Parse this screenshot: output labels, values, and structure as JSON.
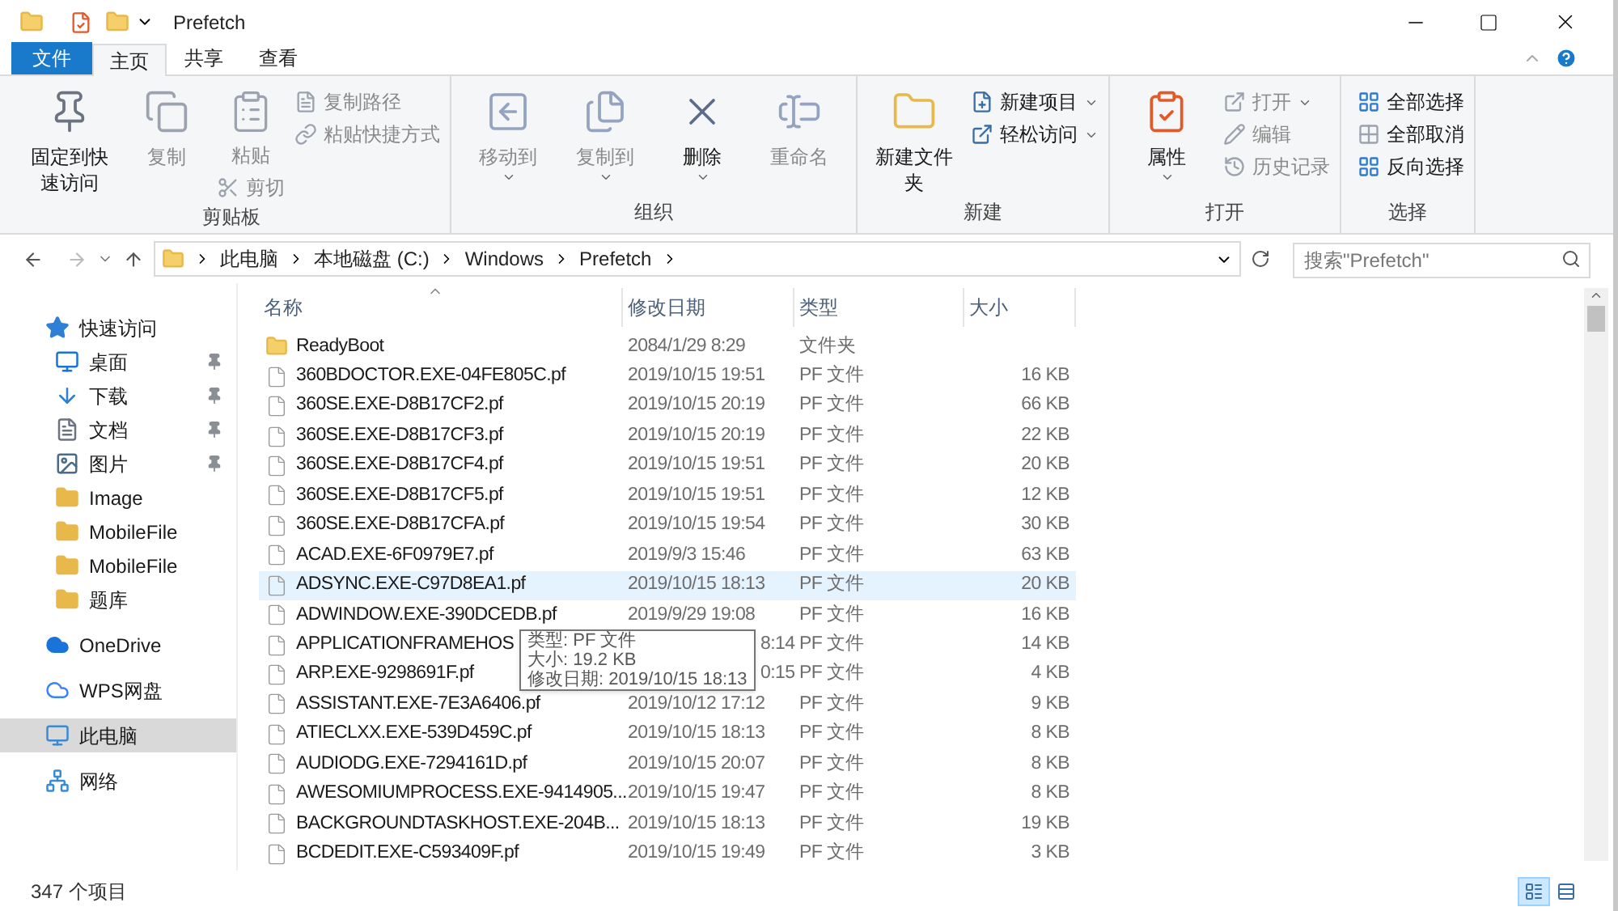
{
  "window": {
    "title": "Prefetch"
  },
  "ribbon_tabs": [
    {
      "label": "文件",
      "kind": "file",
      "selected": false
    },
    {
      "label": "主页",
      "kind": "tab",
      "selected": true
    },
    {
      "label": "共享",
      "kind": "tab",
      "selected": false
    },
    {
      "label": "查看",
      "kind": "tab",
      "selected": false
    }
  ],
  "ribbon_groups": [
    {
      "label": "剪贴板",
      "commands": [
        {
          "label": "固定到快速访问",
          "kind": "large",
          "disabled": false
        },
        {
          "label": "复制",
          "kind": "large",
          "disabled": true
        },
        {
          "label": "粘贴",
          "kind": "paste",
          "disabled": true
        },
        {
          "label": "剪切",
          "kind": "cut",
          "disabled": true
        },
        {
          "label": "复制路径",
          "kind": "small",
          "disabled": true
        },
        {
          "label": "粘贴快捷方式",
          "kind": "small",
          "disabled": true
        }
      ]
    },
    {
      "label": "组织",
      "commands": [
        {
          "label": "移动到",
          "kind": "large",
          "disabled": true,
          "dropdown": true
        },
        {
          "label": "复制到",
          "kind": "large",
          "disabled": true,
          "dropdown": true
        },
        {
          "label": "删除",
          "kind": "large",
          "disabled": false,
          "dropdown": true
        },
        {
          "label": "重命名",
          "kind": "large",
          "disabled": true
        }
      ]
    },
    {
      "label": "新建",
      "commands": [
        {
          "label": "新建文件夹",
          "kind": "large",
          "disabled": false
        },
        {
          "label": "新建项目",
          "kind": "small",
          "disabled": false,
          "dropdown": true
        },
        {
          "label": "轻松访问",
          "kind": "small",
          "disabled": false,
          "dropdown": true
        }
      ]
    },
    {
      "label": "打开",
      "commands": [
        {
          "label": "属性",
          "kind": "large",
          "disabled": false,
          "dropdown": true
        },
        {
          "label": "打开",
          "kind": "small",
          "disabled": true,
          "dropdown": true
        },
        {
          "label": "编辑",
          "kind": "small",
          "disabled": true
        },
        {
          "label": "历史记录",
          "kind": "small",
          "disabled": true
        }
      ]
    },
    {
      "label": "选择",
      "commands": [
        {
          "label": "全部选择",
          "kind": "small",
          "disabled": false
        },
        {
          "label": "全部取消",
          "kind": "small",
          "disabled": false
        },
        {
          "label": "反向选择",
          "kind": "small",
          "disabled": false
        }
      ]
    }
  ],
  "address": {
    "breadcrumbs": [
      "此电脑",
      "本地磁盘 (C:)",
      "Windows",
      "Prefetch"
    ]
  },
  "search": {
    "placeholder": "搜索\"Prefetch\""
  },
  "sidebar": [
    {
      "label": "快速访问",
      "kind": "star",
      "selected": false,
      "children": [
        {
          "label": "桌面",
          "kind": "desktop",
          "pinned": true,
          "selected": false
        },
        {
          "label": "下载",
          "kind": "download",
          "pinned": true,
          "selected": false
        },
        {
          "label": "文档",
          "kind": "document",
          "pinned": true,
          "selected": false
        },
        {
          "label": "图片",
          "kind": "picture",
          "pinned": true,
          "selected": false
        },
        {
          "label": "Image",
          "kind": "folder",
          "pinned": false,
          "selected": false
        },
        {
          "label": "MobileFile",
          "kind": "folder",
          "pinned": false,
          "selected": false
        },
        {
          "label": "MobileFile",
          "kind": "folder",
          "pinned": false,
          "selected": false
        },
        {
          "label": "题库",
          "kind": "folder",
          "pinned": false,
          "selected": false
        }
      ]
    },
    {
      "label": "OneDrive",
      "kind": "cloud",
      "selected": false
    },
    {
      "label": "WPS网盘",
      "kind": "outline",
      "selected": false
    },
    {
      "label": "此电脑",
      "kind": "computer",
      "selected": true
    },
    {
      "label": "网络",
      "kind": "network",
      "selected": false
    }
  ],
  "columns": [
    {
      "label": "名称",
      "sorted": true
    },
    {
      "label": "修改日期",
      "sorted": false
    },
    {
      "label": "类型",
      "sorted": false
    },
    {
      "label": "大小",
      "sorted": false
    }
  ],
  "rows": [
    {
      "name": "ReadyBoot",
      "date": "2084/1/29 8:29",
      "type": "文件夹",
      "kind": "folder",
      "highlighted": false
    },
    {
      "name": "360BDOCTOR.EXE-04FE805C.pf",
      "date": "2019/10/15 19:51",
      "type": "PF 文件",
      "size": "16 KB",
      "kind": "file",
      "highlighted": false
    },
    {
      "name": "360SE.EXE-D8B17CF2.pf",
      "date": "2019/10/15 20:19",
      "type": "PF 文件",
      "size": "66 KB",
      "kind": "file",
      "highlighted": false
    },
    {
      "name": "360SE.EXE-D8B17CF3.pf",
      "date": "2019/10/15 20:19",
      "type": "PF 文件",
      "size": "22 KB",
      "kind": "file",
      "highlighted": false
    },
    {
      "name": "360SE.EXE-D8B17CF4.pf",
      "date": "2019/10/15 19:51",
      "type": "PF 文件",
      "size": "20 KB",
      "kind": "file",
      "highlighted": false
    },
    {
      "name": "360SE.EXE-D8B17CF5.pf",
      "date": "2019/10/15 19:51",
      "type": "PF 文件",
      "size": "12 KB",
      "kind": "file",
      "highlighted": false
    },
    {
      "name": "360SE.EXE-D8B17CFA.pf",
      "date": "2019/10/15 19:54",
      "type": "PF 文件",
      "size": "30 KB",
      "kind": "file",
      "highlighted": false
    },
    {
      "name": "ACAD.EXE-6F0979E7.pf",
      "date": "2019/9/3 15:46",
      "type": "PF 文件",
      "size": "63 KB",
      "kind": "file",
      "highlighted": false
    },
    {
      "name": "ADSYNC.EXE-C97D8EA1.pf",
      "date": "2019/10/15 18:13",
      "type": "PF 文件",
      "size": "20 KB",
      "kind": "file",
      "highlighted": true
    },
    {
      "name": "ADWINDOW.EXE-390DCEDB.pf",
      "date": "2019/9/29 19:08",
      "type": "PF 文件",
      "size": "16 KB",
      "kind": "file",
      "highlighted": false
    },
    {
      "name": "APPLICATIONFRAMEHOS",
      "date": "8:14",
      "type": "PF 文件",
      "size": "14 KB",
      "kind": "file",
      "highlighted": false,
      "covered": true
    },
    {
      "name": "ARP.EXE-9298691F.pf",
      "date": "0:15",
      "type": "PF 文件",
      "size": "4 KB",
      "kind": "file",
      "highlighted": false,
      "covered": true
    },
    {
      "name": "ASSISTANT.EXE-7E3A6406.pf",
      "date": "2019/10/12 17:12",
      "type": "PF 文件",
      "size": "9 KB",
      "kind": "file",
      "highlighted": false
    },
    {
      "name": "ATIECLXX.EXE-539D459C.pf",
      "date": "2019/10/15 18:13",
      "type": "PF 文件",
      "size": "8 KB",
      "kind": "file",
      "highlighted": false
    },
    {
      "name": "AUDIODG.EXE-7294161D.pf",
      "date": "2019/10/15 20:07",
      "type": "PF 文件",
      "size": "8 KB",
      "kind": "file",
      "highlighted": false
    },
    {
      "name": "AWESOMIUMPROCESS.EXE-9414905...",
      "date": "2019/10/15 19:47",
      "type": "PF 文件",
      "size": "8 KB",
      "kind": "file",
      "highlighted": false
    },
    {
      "name": "BACKGROUNDTASKHOST.EXE-204B...",
      "date": "2019/10/15 18:13",
      "type": "PF 文件",
      "size": "19 KB",
      "kind": "file",
      "highlighted": false
    },
    {
      "name": "BCDEDIT.EXE-C593409F.pf",
      "date": "2019/10/15 19:49",
      "type": "PF 文件",
      "size": "3 KB",
      "kind": "file",
      "highlighted": false
    }
  ],
  "tooltip": {
    "lines": [
      "类型: PF 文件",
      "大小: 19.2 KB",
      "修改日期: 2019/10/15 18:13"
    ]
  },
  "status_bar": {
    "count": "347 个项目",
    "views": [
      {
        "kind": "details",
        "selected": true
      },
      {
        "kind": "tiles",
        "selected": false
      }
    ]
  }
}
